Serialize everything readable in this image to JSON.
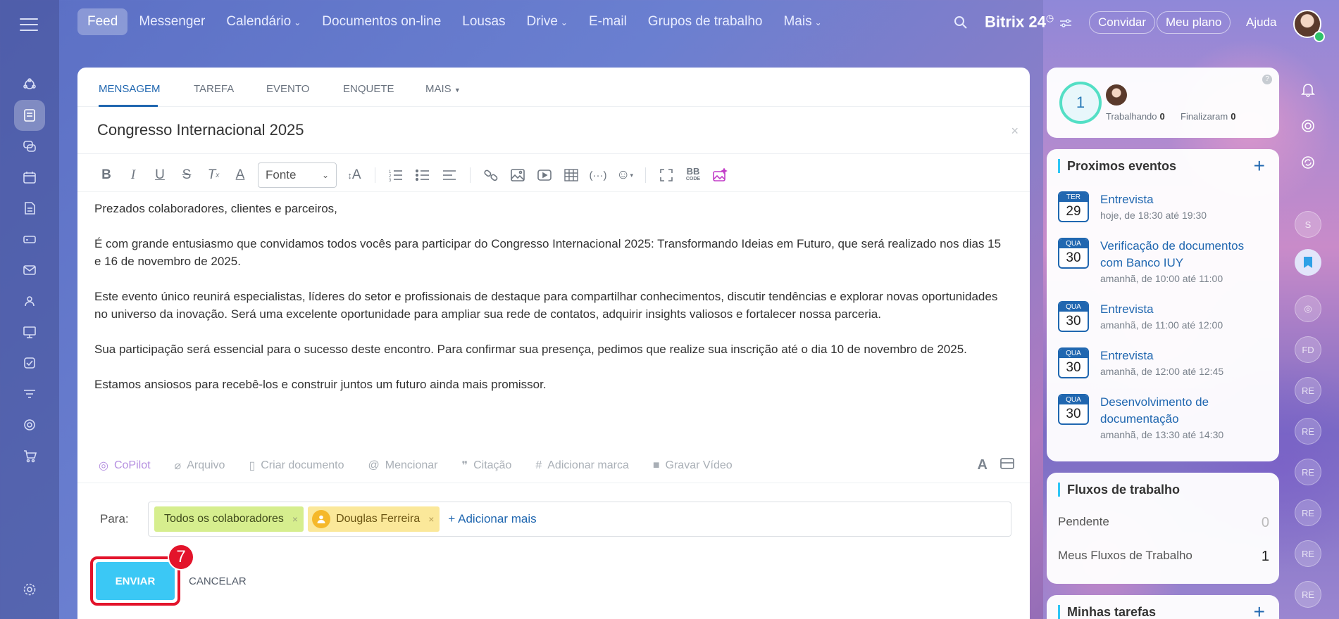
{
  "topnav": {
    "items": [
      "Feed",
      "Messenger",
      "Calendário",
      "Documentos on-line",
      "Lousas",
      "Drive",
      "E-mail",
      "Grupos de trabalho",
      "Mais"
    ],
    "brand": "Bitrix 24",
    "invite": "Convidar",
    "my_plan": "Meu plano",
    "help": "Ajuda"
  },
  "composer": {
    "tabs": [
      "MENSAGEM",
      "TAREFA",
      "EVENTO",
      "ENQUETE",
      "MAIS"
    ],
    "title": "Congresso Internacional 2025",
    "font_select": "Fonte",
    "paragraphs": [
      "Prezados colaboradores, clientes e parceiros,",
      "É com grande entusiasmo que convidamos todos vocês para participar do Congresso Internacional 2025: Transformando Ideias em Futuro, que será realizado nos dias 15 e 16 de novembro de 2025.",
      "Este evento único reunirá especialistas, líderes do setor e profissionais de destaque para compartilhar conhecimentos, discutir tendências e explorar novas oportunidades no universo da inovação. Será uma excelente oportunidade para ampliar sua rede de contatos, adquirir insights valiosos e fortalecer nossa parceria.",
      "Sua participação será essencial para o sucesso deste encontro. Para confirmar sua presença, pedimos que realize sua inscrição até o dia 10 de novembro de 2025.",
      "Estamos ansiosos para recebê-los e construir juntos um futuro ainda mais promissor."
    ],
    "attach": {
      "copilot": "CoPilot",
      "file": "Arquivo",
      "create_doc": "Criar documento",
      "mention": "Mencionar",
      "quote": "Citação",
      "tag": "Adicionar marca",
      "video": "Gravar Vídeo"
    },
    "to_label": "Para:",
    "recipients": [
      "Todos os colaboradores",
      "Douglas Ferreira"
    ],
    "add_more": "+ Adicionar mais",
    "send": "ENVIAR",
    "cancel": "CANCELAR",
    "step_badge": "7"
  },
  "status_widget": {
    "count": "1",
    "working_label": "Trabalhando",
    "working_count": "0",
    "finished_label": "Finalizaram",
    "finished_count": "0"
  },
  "events_widget": {
    "title": "Proximos eventos",
    "events": [
      {
        "weekday": "TER",
        "day": "29",
        "title": "Entrevista",
        "time": "hoje, de 18:30 até 19:30"
      },
      {
        "weekday": "QUA",
        "day": "30",
        "title": "Verificação de documentos com Banco IUY",
        "time": "amanhã, de 10:00 até 11:00"
      },
      {
        "weekday": "QUA",
        "day": "30",
        "title": "Entrevista",
        "time": "amanhã, de 11:00 até 12:00"
      },
      {
        "weekday": "QUA",
        "day": "30",
        "title": "Entrevista",
        "time": "amanhã, de 12:00 até 12:45"
      },
      {
        "weekday": "QUA",
        "day": "30",
        "title": "Desenvolvimento de documentação",
        "time": "amanhã, de 13:30 até 14:30"
      }
    ]
  },
  "flows_widget": {
    "title": "Fluxos de trabalho",
    "pending_label": "Pendente",
    "pending_count": "0",
    "mine_label": "Meus Fluxos de Trabalho",
    "mine_count": "1"
  },
  "tasks_widget": {
    "title": "Minhas tarefas"
  },
  "right_strip": {
    "initials": [
      "S",
      "FD",
      "RE",
      "RE",
      "RE",
      "RE",
      "RE",
      "RE"
    ]
  },
  "colors": {
    "accent": "#2067b0",
    "send_button": "#3bc8f5",
    "highlight": "#e3142b",
    "chip_all": "#d6ee8e",
    "chip_user": "#fbe89a"
  }
}
